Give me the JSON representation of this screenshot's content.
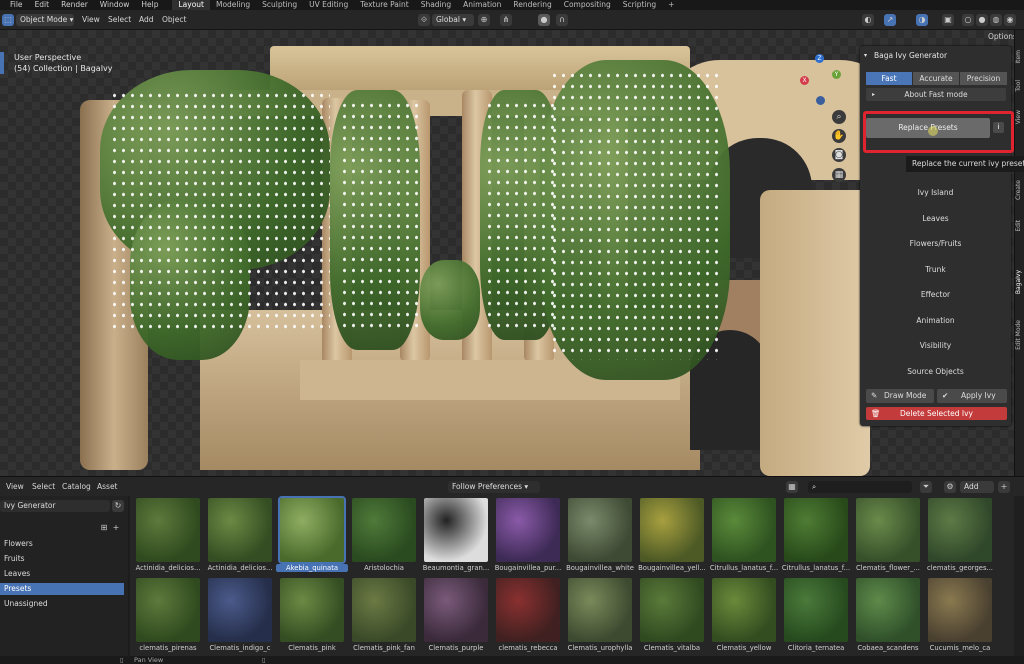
{
  "menu": [
    "File",
    "Edit",
    "Render",
    "Window",
    "Help"
  ],
  "workspaces": [
    {
      "label": "Layout",
      "active": true
    },
    {
      "label": "Modeling"
    },
    {
      "label": "Sculpting"
    },
    {
      "label": "UV Editing"
    },
    {
      "label": "Texture Paint"
    },
    {
      "label": "Shading"
    },
    {
      "label": "Animation"
    },
    {
      "label": "Rendering"
    },
    {
      "label": "Compositing"
    },
    {
      "label": "Scripting"
    }
  ],
  "add_workspace": "+",
  "header": {
    "mode": "Object Mode",
    "view": "View",
    "select": "Select",
    "add": "Add",
    "object": "Object",
    "transform": "Global",
    "options": "Options"
  },
  "viewport": {
    "perspective": "User Perspective",
    "collection": "(54) Collection | BagaIvy"
  },
  "gizmo": {
    "x": "X",
    "y": "Y",
    "z": "Z"
  },
  "ivy_panel": {
    "title": "Baga Ivy Generator",
    "modes": [
      "Fast",
      "Accurate",
      "Precision"
    ],
    "about": "About Fast mode",
    "replace": "Replace Presets",
    "info": "i",
    "tooltip": "Replace the current ivy preset by",
    "sections": [
      "Ivy Island",
      "Leaves",
      "Flowers/Fruits",
      "Trunk",
      "Effector",
      "Animation",
      "Visibility",
      "Source Objects"
    ],
    "draw_mode": "Draw Mode",
    "apply": "Apply Ivy",
    "delete": "Delete Selected Ivy"
  },
  "side_tabs": [
    "Item",
    "Tool",
    "View",
    "Create",
    "Edit",
    "BagaIvy",
    "Edit Mode"
  ],
  "asset_browser": {
    "menu": [
      "View",
      "Select",
      "Catalog",
      "Asset"
    ],
    "library": "Ivy Generator",
    "import_method": "Follow Preferences",
    "add": "Add",
    "tree": [
      "Flowers",
      "Fruits",
      "Leaves",
      "Presets",
      "Unassigned"
    ],
    "tree_selected": "Presets",
    "row1": [
      "Actinidia_delicios...",
      "Actinidia_delicios...",
      "Akebia_quinata",
      "Aristolochia",
      "Beaumontia_gran...",
      "Bougainvillea_pur...",
      "Bougainvillea_white",
      "Bougainvillea_yell...",
      "Citrullus_lanatus_f...",
      "Citrullus_lanatus_f...",
      "Clematis_flower_...",
      "clematis_georges..."
    ],
    "row2": [
      "clematis_pirenas",
      "Clematis_indigo_c",
      "Clematis_pink",
      "Clematis_pink_fan",
      "Clematis_purple",
      "clematis_rebecca",
      "Clematis_urophylla",
      "Clematis_vitalba",
      "Clematis_yellow",
      "Clitoria_ternatea",
      "Cobaea_scandens",
      "Cucumis_melo_ca"
    ],
    "selected": "Akebia_quinata"
  },
  "status": {
    "pan": "Pan View"
  }
}
